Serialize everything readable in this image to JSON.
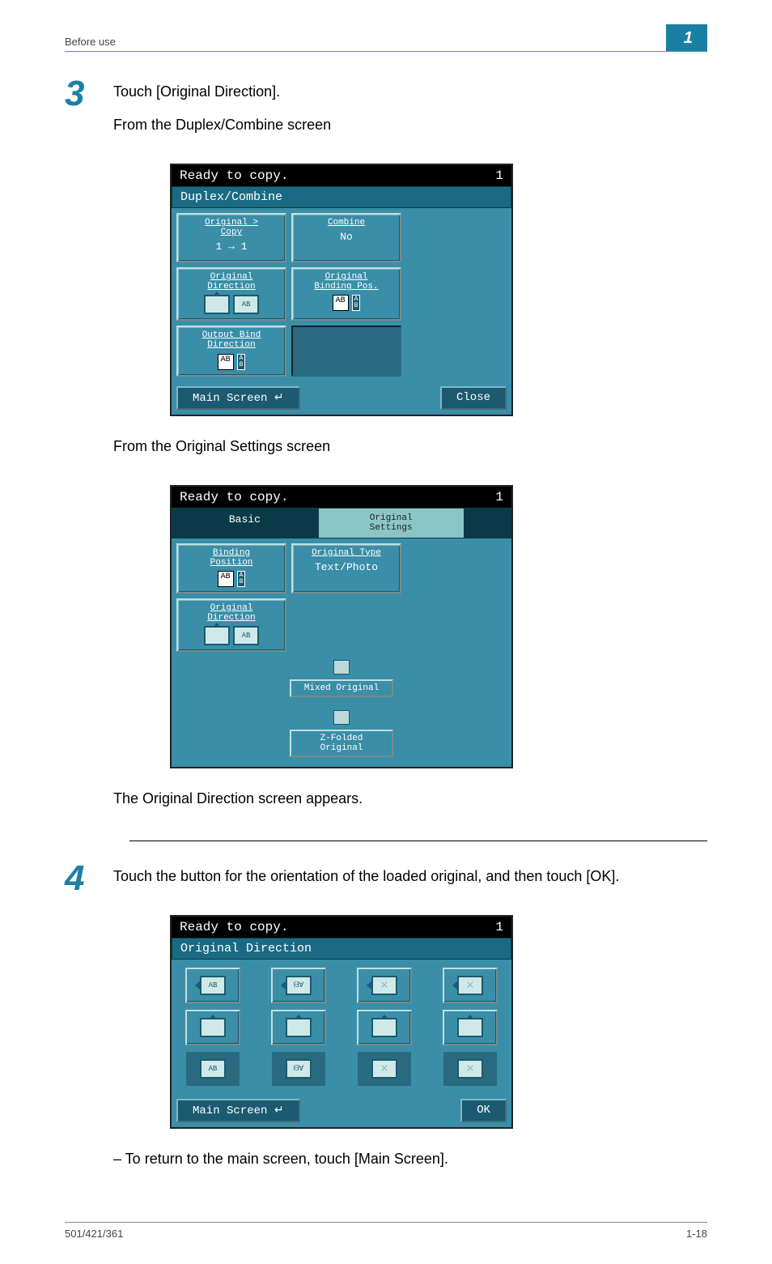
{
  "header": {
    "left": "Before use",
    "chapter": "1"
  },
  "step3": {
    "num": "3",
    "line1": "Touch [Original Direction].",
    "line2": "From the Duplex/Combine screen",
    "line3": "From the Original Settings screen",
    "line4": "The Original Direction screen appears."
  },
  "step4": {
    "num": "4",
    "line1": "Touch the button for the orientation of the loaded original, and then touch [OK].",
    "bullet": "–  To return to the main screen, touch [Main Screen]."
  },
  "panel1": {
    "status": "Ready to copy.",
    "count": "1",
    "title": "Duplex/Combine",
    "cells": {
      "a": {
        "label": "Original >\nCopy",
        "value": "1 → 1"
      },
      "b": {
        "label": "Combine",
        "value": "No"
      },
      "c": {
        "label": "Original\nDirection"
      },
      "d": {
        "label": "Original\nBinding Pos."
      },
      "e": {
        "label": "Output Bind\nDirection"
      }
    },
    "main": "Main Screen",
    "close": "Close"
  },
  "panel2": {
    "status": "Ready to copy.",
    "count": "1",
    "tab_basic": "Basic",
    "tab_orig": "Original\nSettings",
    "cells": {
      "a": {
        "label": "Binding\nPosition"
      },
      "b": {
        "label": "Original Type",
        "value": "Text/Photo"
      },
      "c": {
        "label": "Original\nDirection"
      }
    },
    "mixed": "Mixed Original",
    "zfold": "Z-Folded\nOriginal"
  },
  "panel3": {
    "status": "Ready to copy.",
    "count": "1",
    "title": "Original Direction",
    "main": "Main Screen",
    "ok": "OK"
  },
  "footer": {
    "left": "501/421/361",
    "right": "1-18"
  }
}
